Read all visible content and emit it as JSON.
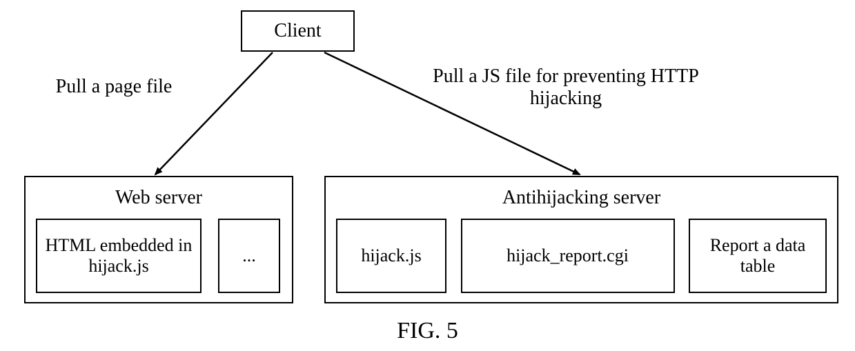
{
  "nodes": {
    "client": "Client",
    "webserver": {
      "title": "Web server",
      "items": [
        "HTML embedded in hijack.js",
        "..."
      ]
    },
    "antiserver": {
      "title": "Antihijacking server",
      "items": [
        "hijack.js",
        "hijack_report.cgi",
        "Report a data table"
      ]
    }
  },
  "edges": {
    "left": "Pull a page file",
    "right": "Pull a JS file for preventing HTTP hijacking"
  },
  "caption": "FIG. 5"
}
